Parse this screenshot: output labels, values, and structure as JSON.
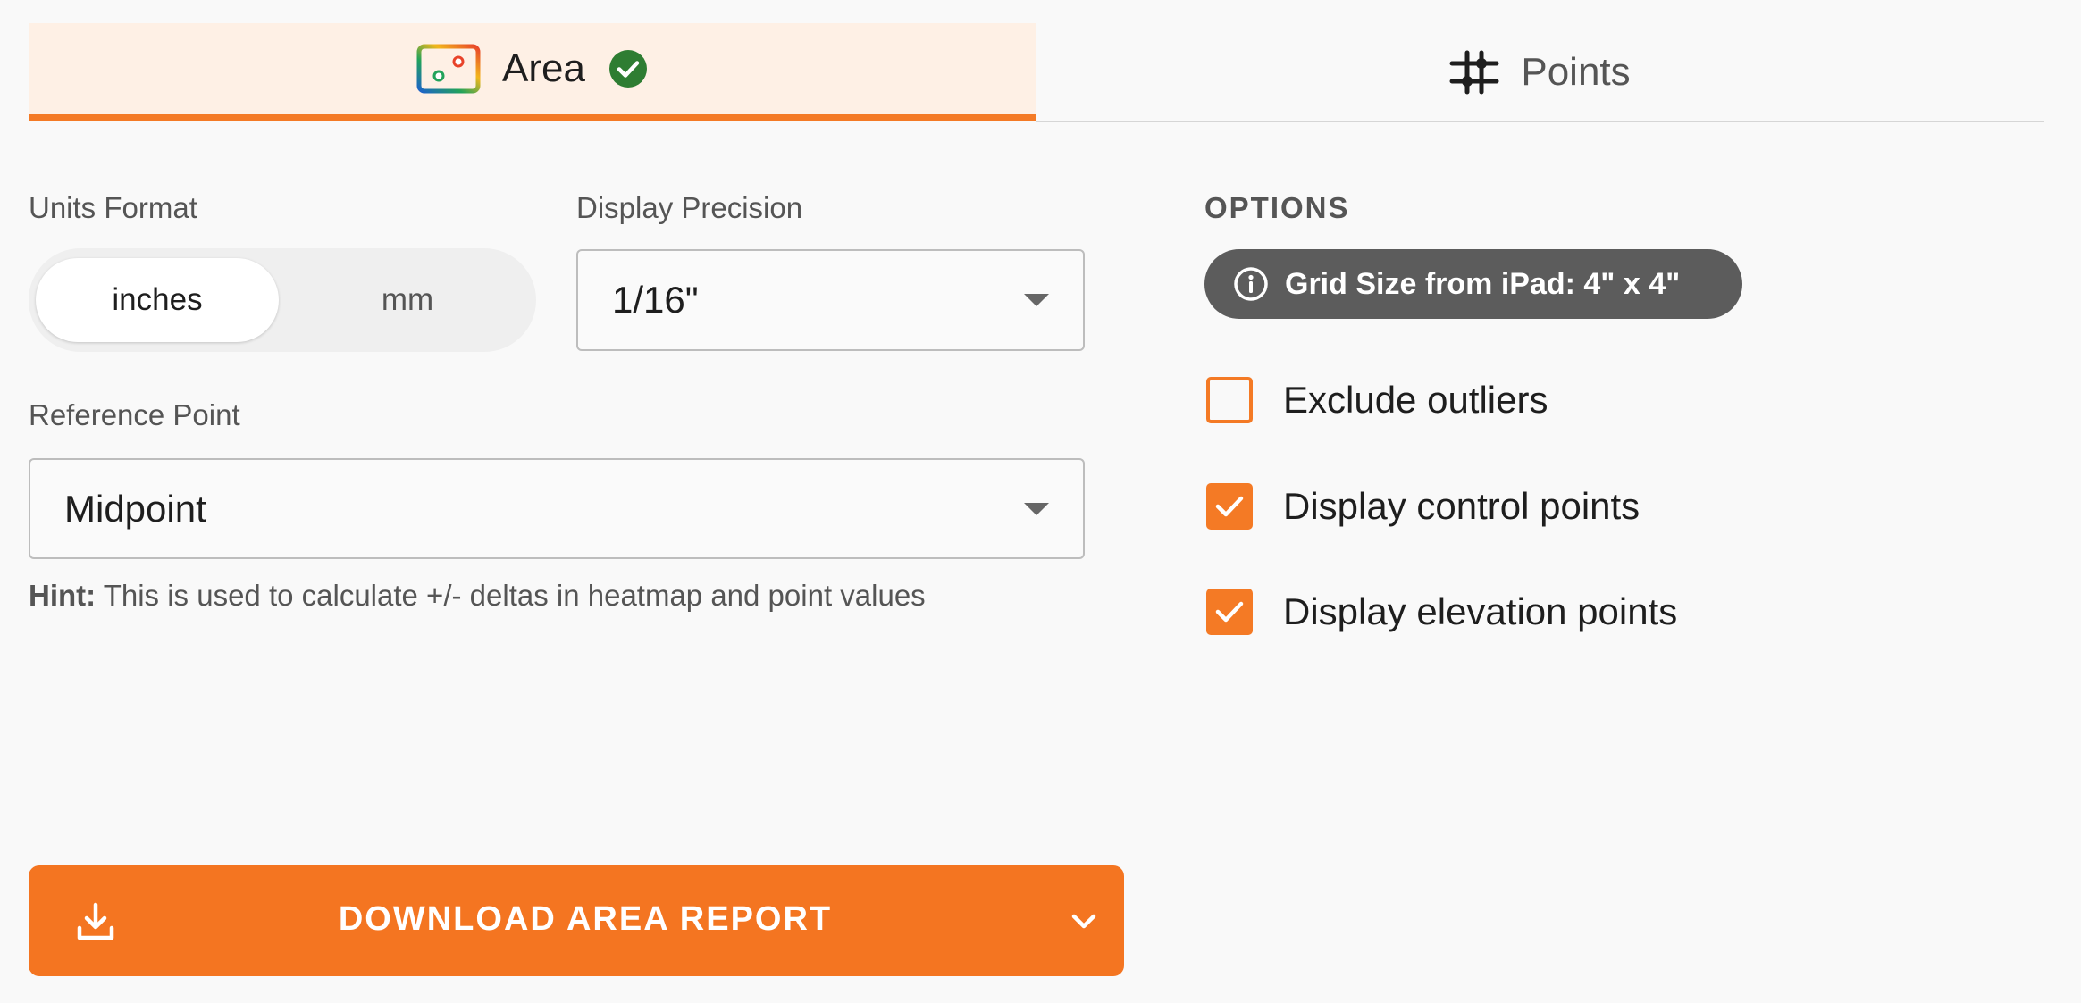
{
  "tabs": [
    {
      "label": "Area",
      "icon": "heatmap-grid-icon",
      "active": true,
      "status_icon": "check-circle-icon"
    },
    {
      "label": "Points",
      "icon": "points-grid-icon",
      "active": false
    }
  ],
  "units": {
    "label": "Units Format",
    "options": [
      "inches",
      "mm"
    ],
    "selected": "inches"
  },
  "precision": {
    "label": "Display Precision",
    "value": "1/16\""
  },
  "reference": {
    "label": "Reference Point",
    "value": "Midpoint",
    "hint_bold": "Hint:",
    "hint_text": " This is used to calculate +/- deltas in heatmap and point values"
  },
  "options": {
    "title": "OPTIONS",
    "grid_pill": "Grid Size from iPad: 4\" x 4\"",
    "checkboxes": [
      {
        "label": "Exclude outliers",
        "checked": false
      },
      {
        "label": "Display control points",
        "checked": true
      },
      {
        "label": "Display elevation points",
        "checked": true
      }
    ]
  },
  "download": {
    "label": "DOWNLOAD AREA REPORT",
    "icon": "download-icon",
    "menu_icon": "chevron-down-icon"
  },
  "colors": {
    "accent": "#f47a25",
    "active_tab_bg": "#fef0e5",
    "pill_bg": "#5c5c5c",
    "check_green": "#2e7d32"
  }
}
